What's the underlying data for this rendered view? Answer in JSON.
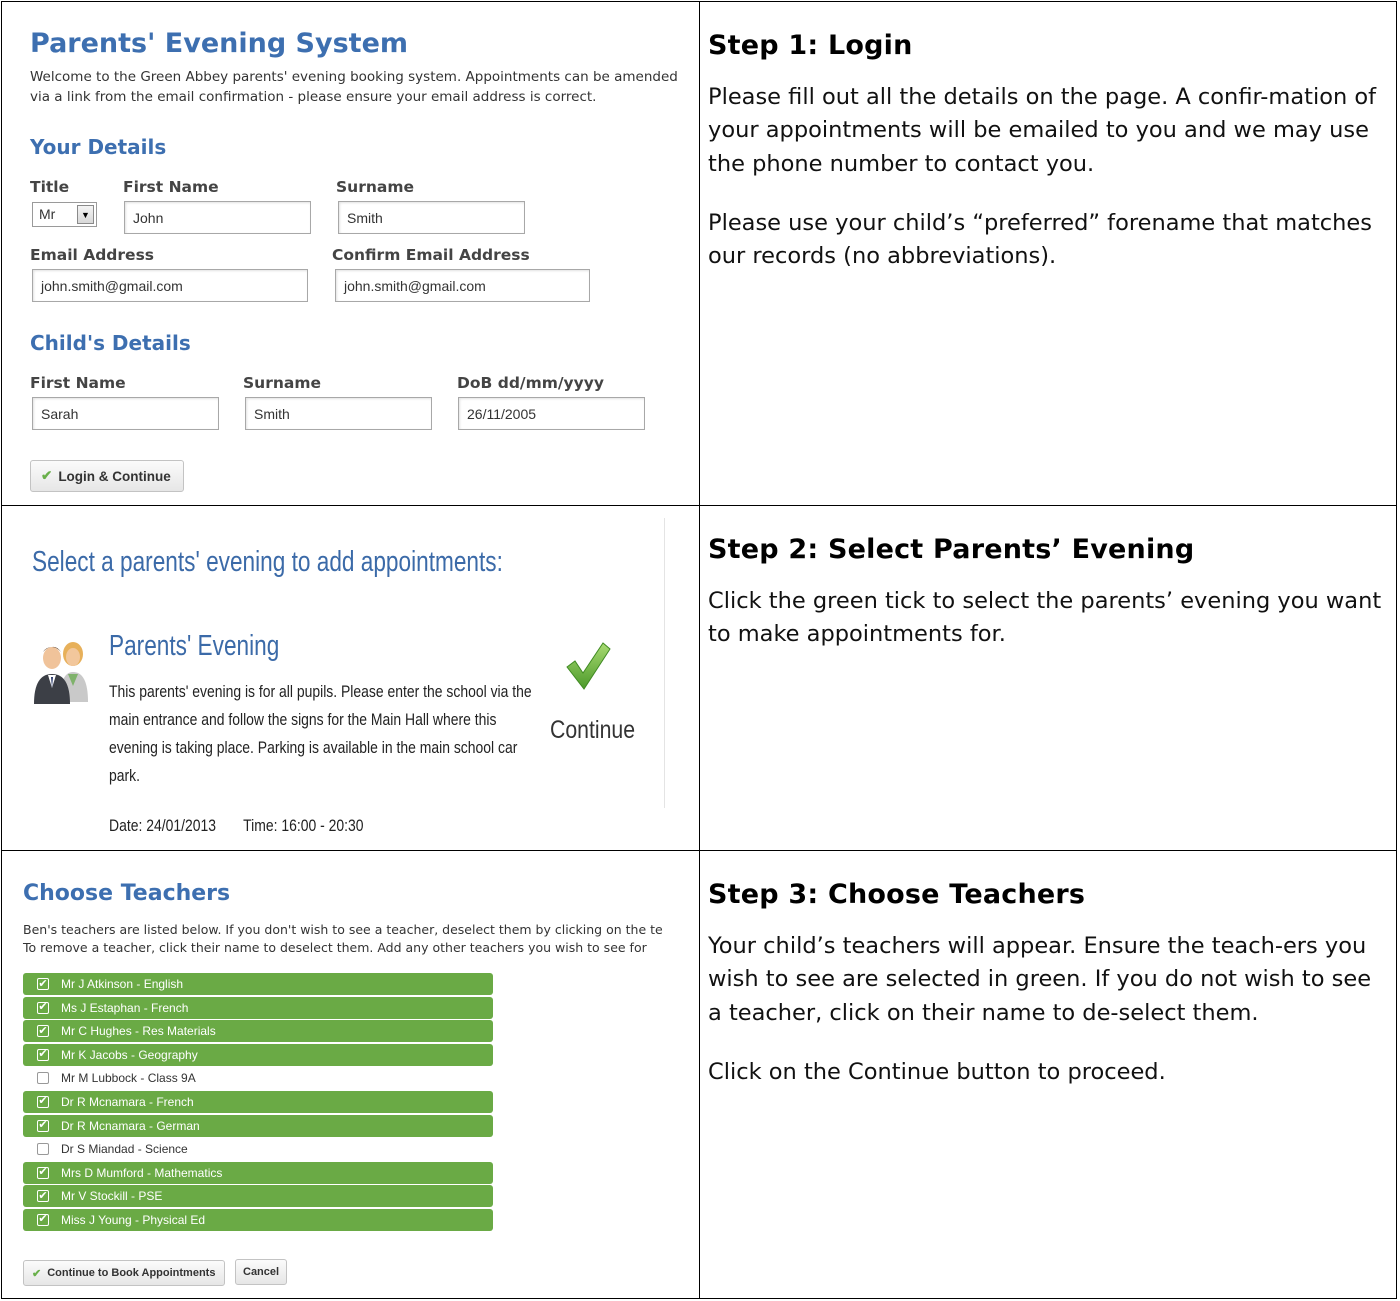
{
  "panel1": {
    "title": "Parents' Evening System",
    "intro_line1": "Welcome to the Green Abbey parents' evening booking system. Appointments can be amended",
    "intro_line2": "via a link from the email confirmation - please ensure your email address is correct.",
    "your_details": {
      "heading": "Your Details",
      "title_label": "Title",
      "title_value": "Mr",
      "first_name_label": "First Name",
      "first_name_value": "John",
      "surname_label": "Surname",
      "surname_value": "Smith",
      "email_label": "Email Address",
      "email_value": "john.smith@gmail.com",
      "confirm_email_label": "Confirm Email Address",
      "confirm_email_value": "john.smith@gmail.com"
    },
    "child_details": {
      "heading": "Child's Details",
      "first_name_label": "First Name",
      "first_name_value": "Sarah",
      "surname_label": "Surname",
      "surname_value": "Smith",
      "dob_label": "DoB dd/mm/yyyy",
      "dob_value": "26/11/2005"
    },
    "login_button": "Login & Continue"
  },
  "panel2": {
    "heading": "Select a parents' evening to add appointments:",
    "evening_title": "Parents' Evening",
    "evening_desc": "This parents' evening is for all pupils. Please enter the school via the main entrance and follow the signs for the Main Hall where this evening is taking place. Parking is available in the main school car park.",
    "date_text": "Date: 24/01/2013",
    "time_text": "Time: 16:00 - 20:30",
    "continue_label": "Continue"
  },
  "panel3": {
    "heading": "Choose Teachers",
    "intro_line1": "Ben's teachers are listed below. If you don't wish to see a teacher, deselect them by clicking on the te",
    "intro_line2": "To remove a teacher, click their name to deselect them. Add any other teachers you wish to see for",
    "teachers": [
      {
        "name": "Mr J Atkinson - English",
        "selected": true
      },
      {
        "name": "Ms J Estaphan - French",
        "selected": true
      },
      {
        "name": "Mr C Hughes - Res Materials",
        "selected": true
      },
      {
        "name": "Mr K Jacobs - Geography",
        "selected": true
      },
      {
        "name": "Mr M Lubbock - Class 9A",
        "selected": false
      },
      {
        "name": "Dr R Mcnamara - French",
        "selected": true
      },
      {
        "name": "Dr R Mcnamara - German",
        "selected": true
      },
      {
        "name": "Dr S Miandad - Science",
        "selected": false
      },
      {
        "name": "Mrs D Mumford - Mathematics",
        "selected": true
      },
      {
        "name": "Mr V Stockill - PSE",
        "selected": true
      },
      {
        "name": "Miss J Young - Physical Ed",
        "selected": true
      }
    ],
    "continue_button": "Continue to Book Appointments",
    "cancel_button": "Cancel"
  },
  "steps": [
    {
      "title": "Step 1: Login",
      "paragraphs": [
        "Please fill out all the details on the page. A confir-mation of your appointments will be emailed to you and we may use the phone number to contact you.",
        "Please use your child’s “preferred” forename that matches our records (no abbreviations)."
      ]
    },
    {
      "title": "Step 2: Select Parents’ Evening",
      "paragraphs": [
        "Click the green tick to select the parents’ evening you want to make appointments for."
      ]
    },
    {
      "title": "Step 3: Choose Teachers",
      "paragraphs": [
        "Your child’s teachers will appear. Ensure the teach-ers you wish to see are selected in green. If you do not wish to see a teacher, click on their name to de-select them.",
        "Click on the Continue button to proceed."
      ]
    }
  ],
  "colors": {
    "heading_blue": "#3d6fb0",
    "selected_green": "#6aaa45",
    "tick_green": "#69b04a"
  }
}
